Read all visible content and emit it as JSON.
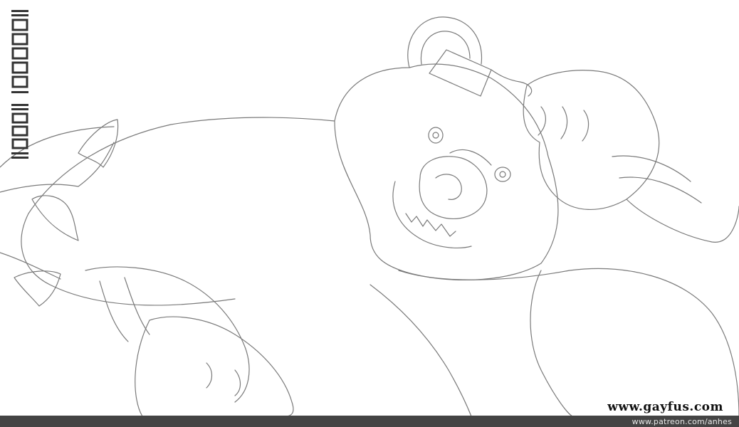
{
  "artwork": {
    "subject": "line-art-bear-illustration",
    "line_color": "#7a7a7a",
    "background_color": "#ffffff"
  },
  "signature": {
    "artist_mark": "anhes",
    "date_mark": "20 07 15"
  },
  "footer": {
    "patreon_url_text": "www.patreon.com/anhes",
    "bar_color": "#444444"
  },
  "watermark": {
    "text": "www.gayfus.com"
  }
}
